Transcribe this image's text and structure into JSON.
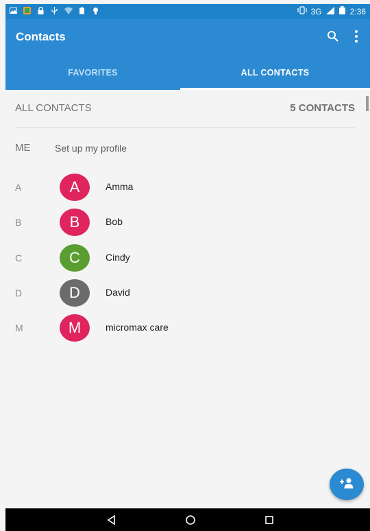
{
  "statusbar": {
    "network": "3G",
    "time": "2:36"
  },
  "appbar": {
    "title": "Contacts"
  },
  "tabs": [
    {
      "label": "FAVORITES"
    },
    {
      "label": "ALL CONTACTS"
    }
  ],
  "list_header": {
    "label": "ALL CONTACTS",
    "count": "5 CONTACTS"
  },
  "me": {
    "label": "ME",
    "text": "Set up my profile"
  },
  "contacts": [
    {
      "section": "A",
      "initial": "A",
      "name": "Amma",
      "color": "#e0245e"
    },
    {
      "section": "B",
      "initial": "B",
      "name": "Bob",
      "color": "#e0245e"
    },
    {
      "section": "C",
      "initial": "C",
      "name": "Cindy",
      "color": "#5a9e32"
    },
    {
      "section": "D",
      "initial": "D",
      "name": "David",
      "color": "#6b6b6b"
    },
    {
      "section": "M",
      "initial": "M",
      "name": "micromax care",
      "color": "#e0245e"
    }
  ],
  "colors": {
    "primary": "#2c8ad2",
    "statusbar": "#1e82c8"
  },
  "icons": {
    "search": "search-icon",
    "more": "more-vert-icon",
    "fab": "add-contact-icon",
    "nav": [
      "back-icon",
      "home-icon",
      "recents-icon"
    ]
  }
}
